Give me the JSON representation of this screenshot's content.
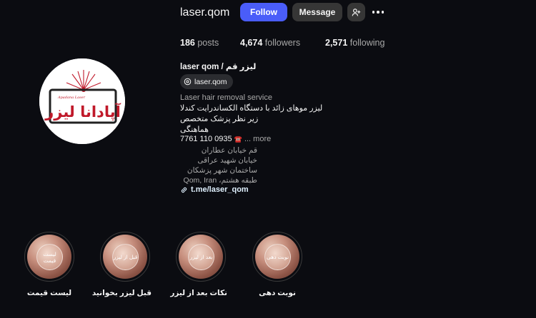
{
  "header": {
    "username": "laser.qom",
    "follow_label": "Follow",
    "message_label": "Message",
    "similar_accounts_icon": "person-plus-icon",
    "options_icon": "more-horizontal-icon"
  },
  "stats": {
    "posts_count": "186",
    "posts_label": "posts",
    "followers_count": "4,674",
    "followers_label": "followers",
    "following_count": "2,571",
    "following_label": "following"
  },
  "profile": {
    "full_name": "laser qom / لیزر قم",
    "threads_handle": "laser.qom",
    "category": "Laser hair removal service",
    "bio": [
      "لیزر موهای زائد با دستگاه الکساندرایت کندلا",
      "زیر نظر پزشک متخصص",
      "هماهنگی"
    ],
    "phone": "7761 110 0935",
    "phone_emoji": "☎️",
    "more_label": "... more",
    "address": [
      "قم خیابان عطاران",
      "خیابان شهید عراقی",
      "ساختمان شهر پزشکان",
      "طبقه هشتم، Qom, Iran"
    ],
    "link": "t.me/laser_qom",
    "avatar_brand_text": "آپادانا لیزر",
    "avatar_small_text": "Apadana Laser"
  },
  "highlights": [
    {
      "label": "لیست قیمت",
      "inner_text": "لیست قیمت"
    },
    {
      "label": "قبل لیزر بخوانید",
      "inner_text": "قبل از لیزر"
    },
    {
      "label": "نکات بعد از لیزر",
      "inner_text": "بعد از لیزر"
    },
    {
      "label": "نوبت دهی",
      "inner_text": "نوبت دهی"
    }
  ],
  "colors": {
    "background": "#0b0c11",
    "follow_button": "#4a5df9",
    "secondary_button": "#363636",
    "link_color": "#e0f1ff",
    "logo_red": "#c0192a"
  }
}
